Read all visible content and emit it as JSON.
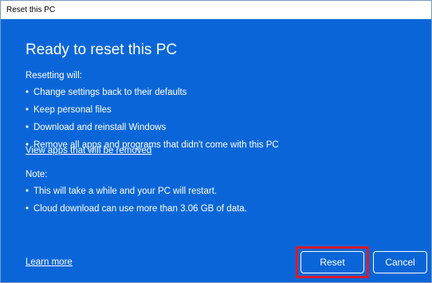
{
  "window": {
    "title": "Reset this PC"
  },
  "content": {
    "heading": "Ready to reset this PC",
    "resetting_label": "Resetting will:",
    "resetting_items": [
      "Change settings back to their defaults",
      "Keep personal files",
      "Download and reinstall Windows",
      "Remove all apps and programs that didn't come with this PC"
    ],
    "view_apps_link": "View apps that will be removed",
    "note_label": "Note:",
    "note_items": [
      "This will take a while and your PC will restart.",
      "Cloud download can use more than 3.06 GB of data."
    ],
    "bullet_glyph": "•"
  },
  "footer": {
    "learn_more_link": "Learn more",
    "reset_label": "Reset",
    "cancel_label": "Cancel"
  },
  "colors": {
    "background": "#0a66d8",
    "highlight": "#d81b2c"
  }
}
